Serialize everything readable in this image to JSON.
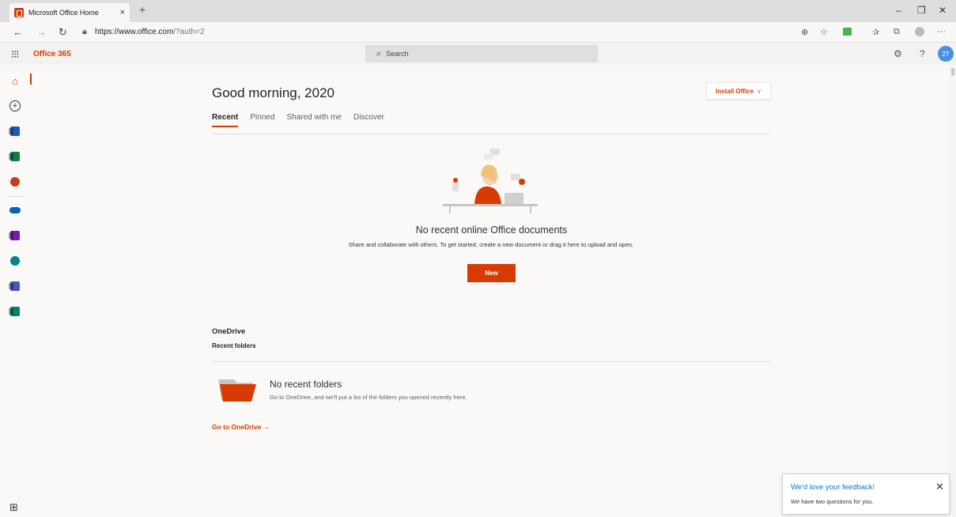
{
  "browser": {
    "tab_title": "Microsoft Office Home",
    "tab_close": "×",
    "new_tab": "+",
    "url_host": "https://www.office.com",
    "url_path": "/?auth=2",
    "min": "–",
    "max": "❐",
    "close": "✕"
  },
  "header": {
    "brand": "Office 365",
    "search_placeholder": "Search",
    "avatar_initials": "2T"
  },
  "main": {
    "greeting": "Good morning, 2020",
    "install_label": "Install Office",
    "tabs": [
      {
        "label": "Recent"
      },
      {
        "label": "Pinned"
      },
      {
        "label": "Shared with me"
      },
      {
        "label": "Discover"
      }
    ],
    "empty_title": "No recent online Office documents",
    "empty_sub": "Share and collaborate with others. To get started, create a new document or drag it here to upload and open.",
    "new_label": "New"
  },
  "onedrive": {
    "title": "OneDrive",
    "recent_folders": "Recent folders",
    "no_folders_title": "No recent folders",
    "no_folders_sub": "Go to OneDrive, and we'll put a list of the folders you opened recently here.",
    "goto_label": "Go to OneDrive"
  },
  "feedback": {
    "title": "We'd love your feedback!",
    "sub": "We have two questions for you."
  },
  "colors": {
    "accent": "#d83b01",
    "word": "#185abd",
    "excel": "#107c41",
    "powerpoint": "#c43e1c",
    "onedrive": "#0364b8",
    "onenote": "#7719aa",
    "sharepoint": "#038387",
    "teams": "#4b53bc",
    "sway": "#008272"
  }
}
